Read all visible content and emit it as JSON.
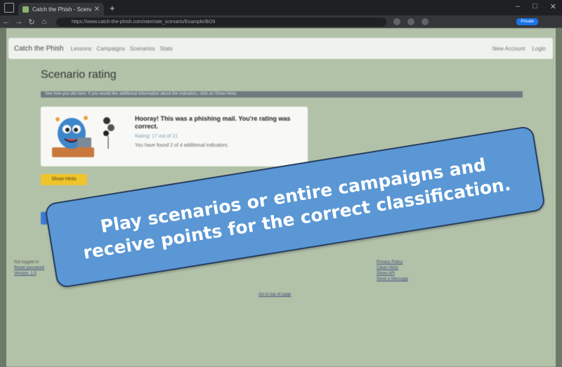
{
  "browser": {
    "tab_title": "Catch the Phish - Scenario rating",
    "url": "https://www.catch-the-phish.com/rate/rate_scenario/Example/BO9",
    "profile_label": "Private"
  },
  "navbar": {
    "brand": "Catch the Phish",
    "links": [
      "Lessons",
      "Campaigns",
      "Scenarios",
      "Stats"
    ],
    "new_account": "New Account",
    "login": "Login"
  },
  "page": {
    "title": "Scenario rating",
    "info": "See how you did here. If you would like additional information about the indicators, click on Show Hints."
  },
  "result_card": {
    "headline": "Hooray! This was a phishing mail. You're rating was correct.",
    "rating": "Rating: 17 out of 21",
    "found": "You have found 2 of 4 additional indicators."
  },
  "hints_button": "Show Hints",
  "footer": {
    "left": [
      "Not logged in",
      "Reset password",
      "Version: 1.0"
    ],
    "right": [
      "Privacy Policy",
      "Clean Hints",
      "Show API",
      "Send a Message"
    ],
    "to_top": "Go to top of page"
  },
  "banner": {
    "line1": "Play scenarios or entire campaigns and",
    "line2": "receive points for the correct classification.",
    "color": "#5a97d4"
  }
}
